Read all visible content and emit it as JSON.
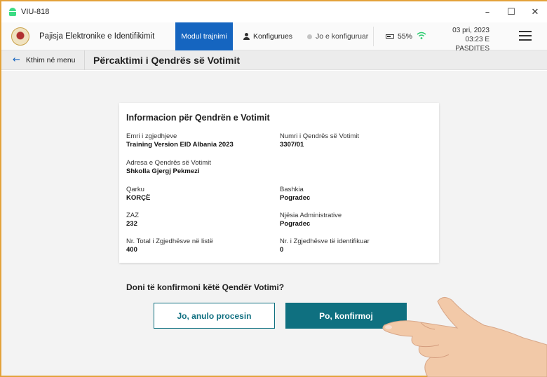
{
  "window": {
    "title": "VIU-818",
    "minimize": "–",
    "maximize": "☐",
    "close": "✕"
  },
  "header": {
    "app_name": "Pajisja Elektronike e Identifikimit",
    "mode_badge": "Modul trajnimi",
    "config_user": "Konfigurues",
    "config_status": "Jo e konfiguruar",
    "battery": "55%",
    "date": "03 pri, 2023",
    "time": "03:23 E PASDITES"
  },
  "subheader": {
    "back_label": "Kthim në menu",
    "page_title": "Përcaktimi i Qendrës së Votimit"
  },
  "card": {
    "title": "Informacion për Qendrën e Votimit",
    "fields": [
      {
        "label": "Emri i zgjedhjeve",
        "value": "Training Version EID Albania 2023"
      },
      {
        "label": "Numri i Qendrës së Votimit",
        "value": "3307/01"
      },
      {
        "label": "Adresa e Qendrës së Votimit",
        "value": "Shkolla Gjergj Pekmezi"
      },
      {
        "label": "Qarku",
        "value": "KORÇË"
      },
      {
        "label": "Bashkia",
        "value": "Pogradec"
      },
      {
        "label": "ZAZ",
        "value": "232"
      },
      {
        "label": "Njësia Administrative",
        "value": "Pogradec"
      },
      {
        "label": "Nr. Total i Zgjedhësve në listë",
        "value": "400"
      },
      {
        "label": "Nr. i Zgjedhësve të identifikuar",
        "value": "0"
      }
    ]
  },
  "confirm": {
    "question": "Doni të konfirmoni këtë Qendër Votimi?",
    "cancel_label": "Jo, anulo procesin",
    "confirm_label": "Po, konfirmoj"
  },
  "colors": {
    "frame": "#e3a23a",
    "primary": "#0f7080",
    "mode_badge": "#1565c0",
    "wifi": "#2ecc71"
  }
}
